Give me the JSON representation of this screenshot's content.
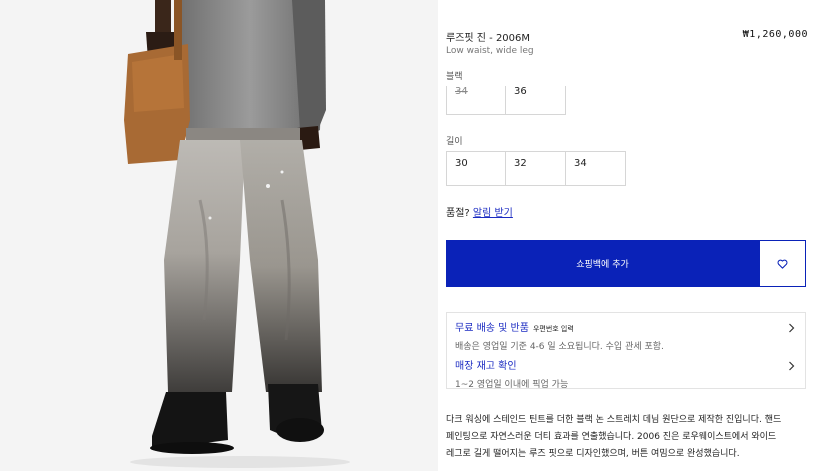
{
  "product": {
    "title": "루즈핏 진 - 2006M",
    "price": "₩1,260,000",
    "subtitle": "Low waist, wide leg"
  },
  "color_option": {
    "label": "블랙",
    "sizes": [
      {
        "value": "34",
        "unavailable": true
      },
      {
        "value": "36",
        "unavailable": false
      }
    ]
  },
  "length_option": {
    "label": "길이",
    "values": [
      "30",
      "32",
      "34"
    ]
  },
  "soldout": {
    "prefix": "품절?",
    "link": "알림 받기"
  },
  "actions": {
    "add_to_bag": "쇼핑백에 추가",
    "wishlist_icon": "heart-icon"
  },
  "info": {
    "shipping_title": "무료 배송 및 반품",
    "shipping_zip": "우편번호 입력",
    "shipping_desc": "배송은 영업일 기준 4-6 일 소요됩니다. 수입 관세 포함.",
    "store_title": "매장 재고 확인",
    "store_desc": "1~2 영업일 이내에 픽업 가능"
  },
  "description": {
    "line1": "다크 워싱에 스테인드 틴트를 더한 블랙 논 스트레치 데님 원단으로 제작한 진입니다. 핸드",
    "line2": "페인팅으로 자연스러운 더티 효과를 연출했습니다. 2006 진은 로우웨이스트에서 와이드",
    "line3": "레그로 길게 떨어지는 루즈 핏으로 디자인했으며, 버튼 여밈으로 완성했습니다."
  },
  "colors": {
    "accent": "#0a22b8",
    "link": "#1b2bc2"
  }
}
